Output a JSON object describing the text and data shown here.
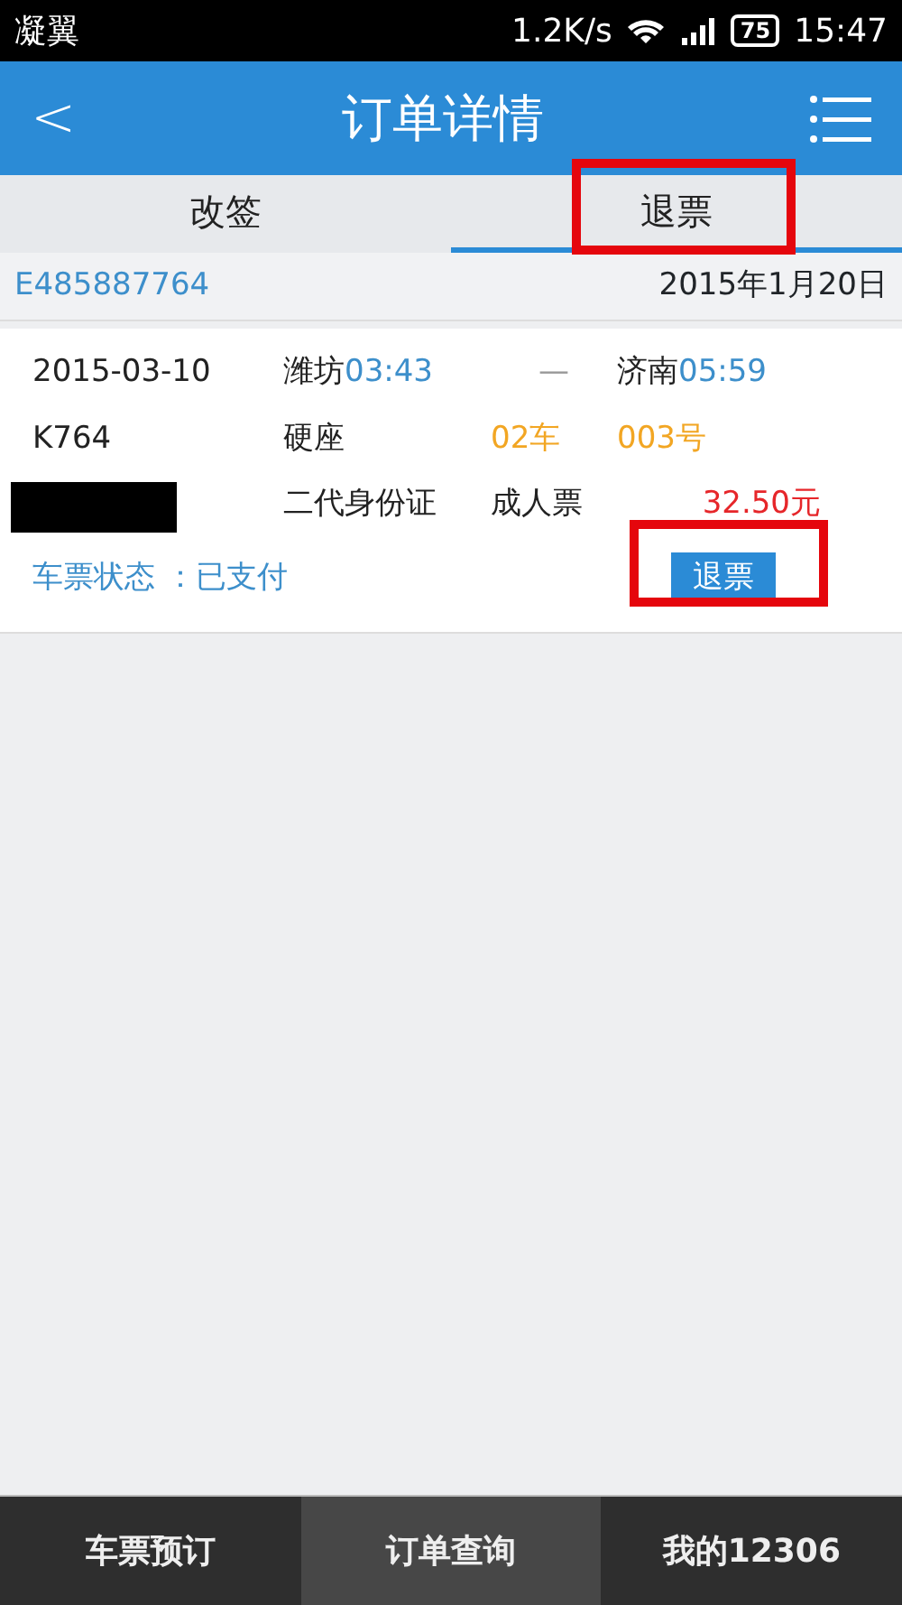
{
  "status_bar": {
    "carrier": "凝翼",
    "speed": "1.2K/s",
    "battery": "75",
    "time": "15:47"
  },
  "header": {
    "back": "<",
    "title": "订单详情"
  },
  "tabs": [
    {
      "label": "改签",
      "selected": false,
      "highlighted": false
    },
    {
      "label": "退票",
      "selected": true,
      "highlighted": true
    }
  ],
  "order": {
    "number": "E485887764",
    "date": "2015年1月20日"
  },
  "ticket": {
    "travel_date": "2015-03-10",
    "from_station": "潍坊",
    "depart_time": "03:43",
    "arrow": "—",
    "to_station": "济南",
    "arrive_time": "05:59",
    "train": "K764",
    "seat_class": "硬座",
    "car": "02车",
    "seat": "003号",
    "passenger_redacted": true,
    "id_type": "二代身份证",
    "ticket_type": "成人票",
    "price": "32.50元",
    "status": "车票状态 ：已支付",
    "refund_button": {
      "label": "退票",
      "highlighted": true
    }
  },
  "bottom_nav": [
    {
      "label": "车票预订",
      "selected": false
    },
    {
      "label": "订单查询",
      "selected": true
    },
    {
      "label": "我的12306",
      "selected": false
    }
  ]
}
